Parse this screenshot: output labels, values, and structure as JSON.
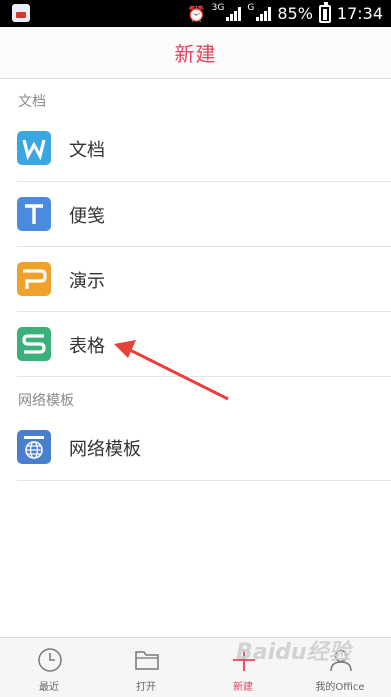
{
  "status_bar": {
    "network_1": "3G",
    "network_2": "G",
    "battery": "85%",
    "time": "17:34"
  },
  "header": {
    "title": "新建"
  },
  "sections": [
    {
      "title": "文档",
      "items": [
        {
          "label": "文档",
          "icon_letter": "W",
          "icon_color": "#3aa7e0"
        },
        {
          "label": "便笺",
          "icon_letter": "T",
          "icon_color": "#4a8be0"
        },
        {
          "label": "演示",
          "icon_letter": "P",
          "icon_color": "#f0a12b"
        },
        {
          "label": "表格",
          "icon_letter": "S",
          "icon_color": "#3bb07a"
        }
      ]
    },
    {
      "title": "网络模板",
      "items": [
        {
          "label": "网络模板",
          "icon": "globe-template-icon",
          "icon_color": "#4a7fd0"
        }
      ]
    }
  ],
  "bottom_nav": [
    {
      "label": "最近",
      "icon": "clock-icon"
    },
    {
      "label": "打开",
      "icon": "folder-icon"
    },
    {
      "label": "新建",
      "icon": "plus-icon",
      "active": true
    },
    {
      "label": "我的Office",
      "icon": "user-icon"
    }
  ],
  "watermark": "Baidu经验",
  "colors": {
    "accent": "#e0445c",
    "arrow": "#e8413a"
  }
}
